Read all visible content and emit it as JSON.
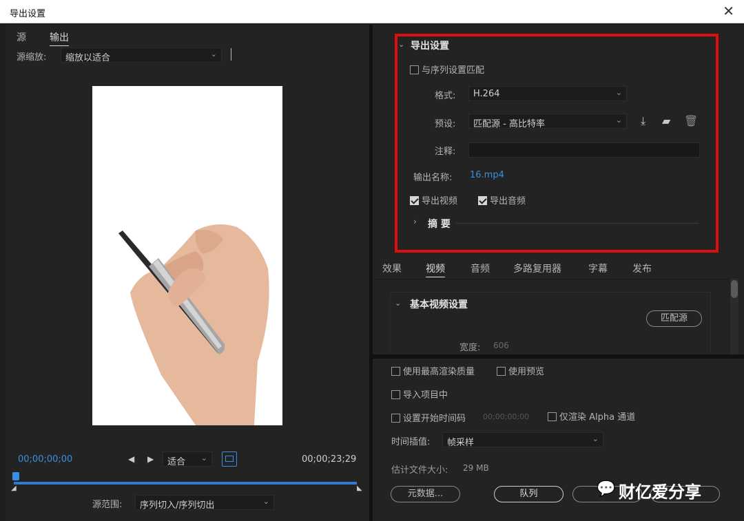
{
  "window": {
    "title": "导出设置",
    "close_glyph": "✕"
  },
  "left": {
    "tabs": [
      {
        "label": "源"
      },
      {
        "label": "输出"
      }
    ],
    "scale_label": "源缩放:",
    "scale_value": "缩放以适合",
    "timecode_start": "00;00;00;00",
    "timecode_end": "00;00;23;29",
    "fit_value": "适合",
    "range_label": "源范围:",
    "range_value": "序列切入/序列切出"
  },
  "export": {
    "section_title": "导出设置",
    "match_sequence": "与序列设置匹配",
    "format_label": "格式:",
    "format_value": "H.264",
    "preset_label": "预设:",
    "preset_value": "匹配源 - 高比特率",
    "comment_label": "注释:",
    "output_name_label": "输出名称:",
    "output_name_value": "16.mp4",
    "export_video": "导出视频",
    "export_audio": "导出音频",
    "summary_label": "摘 要"
  },
  "tabs": [
    {
      "label": "效果"
    },
    {
      "label": "视频"
    },
    {
      "label": "音频"
    },
    {
      "label": "多路复用器"
    },
    {
      "label": "字幕"
    },
    {
      "label": "发布"
    }
  ],
  "video": {
    "section_title": "基本视频设置",
    "match_source_button": "匹配源",
    "width_label": "宽度:",
    "width_value": "606"
  },
  "options": {
    "max_render": "使用最高渲染质量",
    "use_preview": "使用预览",
    "import_project": "导入项目中",
    "set_start_tc": "设置开始时间码",
    "start_tc_value": "00;00;00;00",
    "alpha_only": "仅渲染 Alpha 通道",
    "interp_label": "时间插值:",
    "interp_value": "帧采样",
    "file_size_label": "估计文件大小:",
    "file_size_value": "29 MB",
    "metadata_button": "元数据...",
    "queue_button": "队列",
    "watermark": "财亿爱分享"
  },
  "colors": {
    "accent_blue": "#3b8fe0",
    "highlight_red": "#e00f0f"
  }
}
